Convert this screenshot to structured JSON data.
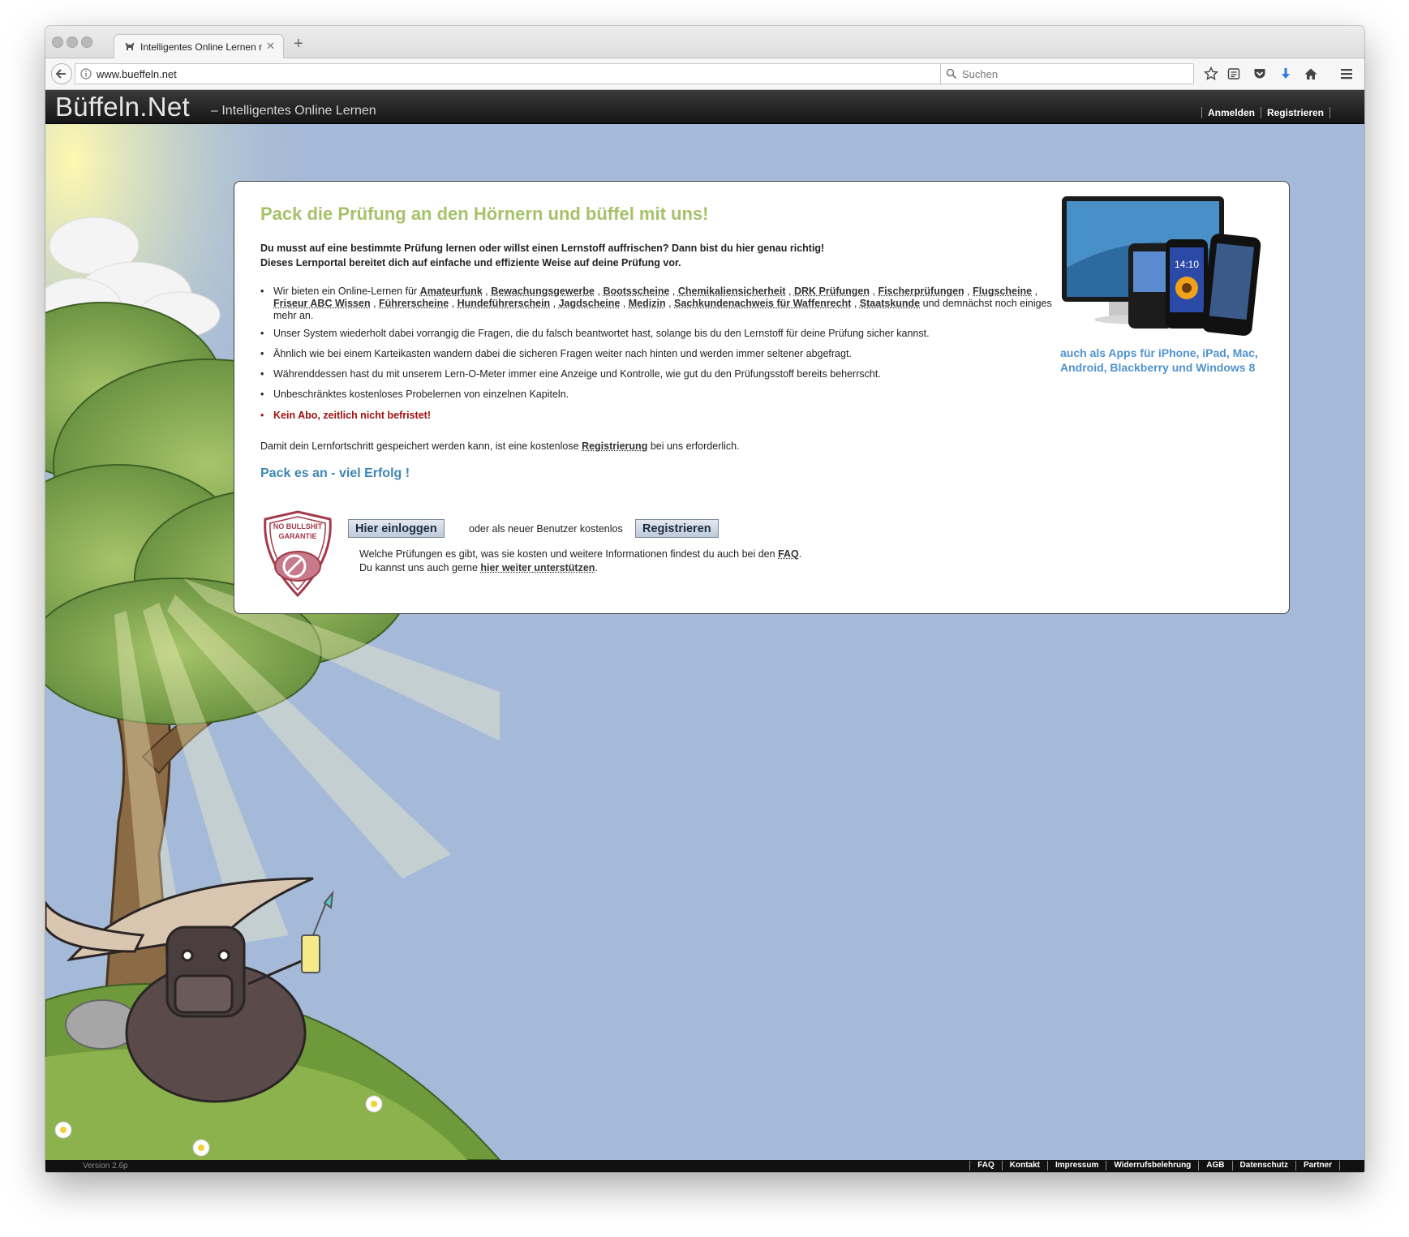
{
  "browser": {
    "tab_title": "Intelligentes Online Lernen mi",
    "url": "www.bueffeln.net",
    "search_placeholder": "Suchen"
  },
  "header": {
    "logo": "Büffeln.Net",
    "slogan": "– Intelligentes Online Lernen",
    "nav": [
      "Anmelden",
      "Registrieren"
    ]
  },
  "card": {
    "headline": "Pack die Prüfung an den Hörnern und büffel mit uns!",
    "intro_1": "Du musst auf eine bestimmte Prüfung lernen oder willst einen Lernstoff auffrischen? Dann bist du hier genau richtig!",
    "intro_2": "Dieses Lernportal bereitet dich auf einfache und effiziente Weise auf deine Prüfung vor.",
    "bullet1_prefix": "Wir bieten ein Online-Lernen für",
    "topics": [
      "Amateurfunk",
      "Bewachungsgewerbe",
      "Bootsscheine",
      "Chemikaliensicherheit",
      "DRK Prüfungen",
      "Fischerprüfungen",
      "Flugscheine",
      "Friseur ABC Wissen",
      "Führerscheine",
      "Hundeführerschein",
      "Jagdscheine",
      "Medizin",
      "Sachkundenachweis für Waffenrecht",
      "Staatskunde"
    ],
    "bullet1_suffix": "und demnächst noch einiges mehr an.",
    "bullets": [
      "Unser System wiederholt dabei vorrangig die Fragen, die du falsch beantwortet hast, solange bis du den Lernstoff für deine Prüfung sicher kannst.",
      "Ähnlich wie bei einem Karteikasten wandern dabei die sicheren Fragen weiter nach hinten und werden immer seltener abgefragt.",
      "Währenddessen hast du mit unserem Lern-O-Meter immer eine Anzeige und Kontrolle, wie gut du den Prüfungsstoff bereits beherrscht.",
      "Unbeschränktes kostenloses Probelernen von einzelnen Kapiteln."
    ],
    "bullet_red": "Kein Abo, zeitlich nicht befristet!",
    "save_prefix": "Damit dein Lernfortschritt gespeichert werden kann, ist eine kostenlose",
    "save_link": "Registrierung",
    "save_suffix": "bei uns erforderlich.",
    "cheer": "Pack es an - viel Erfolg !",
    "badge_line1": "NO BULLSHIT",
    "badge_line2": "GARANTIE",
    "login_button": "Hier einloggen",
    "or_text": "oder als neuer Benutzer kostenlos",
    "register_button": "Registrieren",
    "info_prefix": "Welche Prüfungen es gibt, was sie kosten und weitere Informationen findest du auch bei den",
    "info_link": "FAQ",
    "info_suffix": ".",
    "support_prefix": "Du kannst uns auch gerne",
    "support_link": "hier weiter unterstützen",
    "support_suffix": ".",
    "phone_time": "14:10",
    "apps_line1": "auch als Apps für iPhone, iPad, Mac,",
    "apps_line2": "Android, Blackberry und Windows 8"
  },
  "footer": {
    "version": "Version 2.6p",
    "links": [
      "FAQ",
      "Kontakt",
      "Impressum",
      "Widerrufsbelehrung",
      "AGB",
      "Datenschutz",
      "Partner"
    ]
  },
  "colors": {
    "sky": "#a5b9d8",
    "headline": "#a7c16a",
    "cheer": "#3d86b5",
    "apps": "#4f93ce",
    "red": "#a01010"
  }
}
